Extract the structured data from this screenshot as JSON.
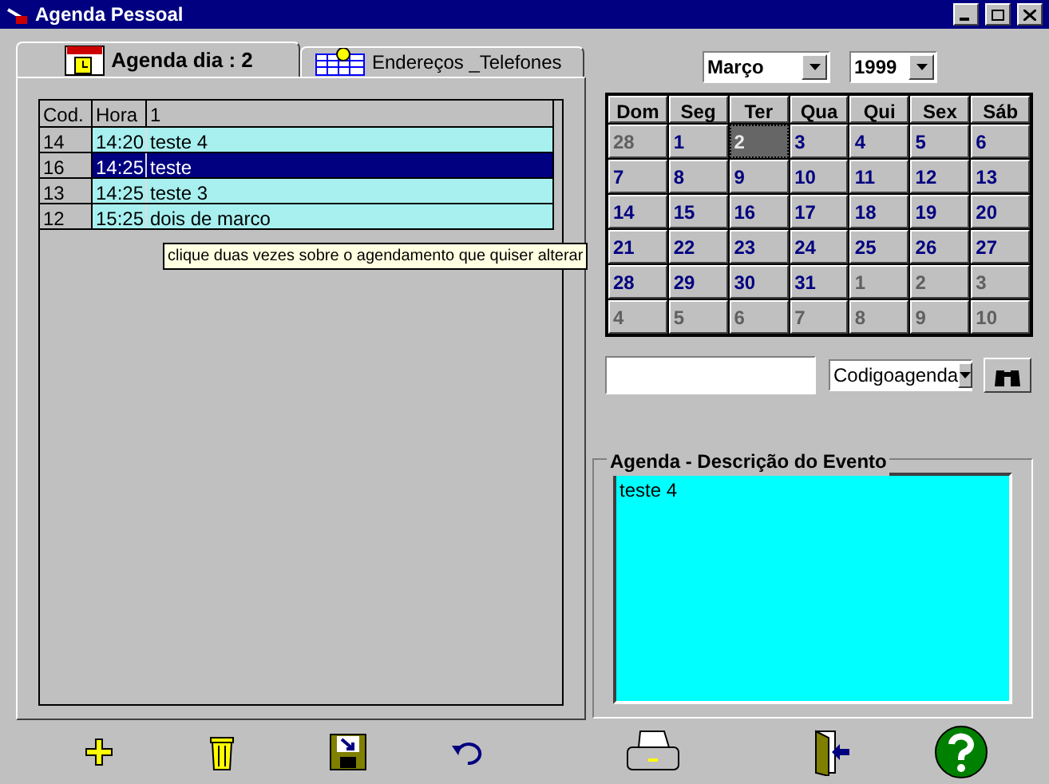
{
  "window": {
    "title": "Agenda Pessoal"
  },
  "tabs": [
    {
      "label": "Agenda dia : 2",
      "selected": true
    },
    {
      "label": "Endereços _Telefones",
      "selected": false
    }
  ],
  "table": {
    "columns": [
      "Cod.",
      "Hora",
      "1"
    ],
    "rows": [
      {
        "cells": [
          "14",
          "14:20",
          "teste 4"
        ],
        "selected": false
      },
      {
        "cells": [
          "16",
          "14:25",
          "teste"
        ],
        "selected": true
      },
      {
        "cells": [
          "13",
          "14:25",
          "teste 3"
        ],
        "selected": false
      },
      {
        "cells": [
          "12",
          "15:25",
          "dois de marco"
        ],
        "selected": false
      }
    ]
  },
  "tooltip": "clique duas vezes sobre o agendamento que quiser alterar",
  "month": "Março",
  "year": "1999",
  "calendar": {
    "weekdays": [
      "Dom",
      "Seg",
      "Ter",
      "Qua",
      "Qui",
      "Sex",
      "Sáb"
    ],
    "days": [
      {
        "day": "28",
        "in_month": false,
        "selected": false
      },
      {
        "day": "1",
        "in_month": true,
        "selected": false
      },
      {
        "day": "2",
        "in_month": true,
        "selected": true
      },
      {
        "day": "3",
        "in_month": true,
        "selected": false
      },
      {
        "day": "4",
        "in_month": true,
        "selected": false
      },
      {
        "day": "5",
        "in_month": true,
        "selected": false
      },
      {
        "day": "6",
        "in_month": true,
        "selected": false
      },
      {
        "day": "7",
        "in_month": true,
        "selected": false
      },
      {
        "day": "8",
        "in_month": true,
        "selected": false
      },
      {
        "day": "9",
        "in_month": true,
        "selected": false
      },
      {
        "day": "10",
        "in_month": true,
        "selected": false
      },
      {
        "day": "11",
        "in_month": true,
        "selected": false
      },
      {
        "day": "12",
        "in_month": true,
        "selected": false
      },
      {
        "day": "13",
        "in_month": true,
        "selected": false
      },
      {
        "day": "14",
        "in_month": true,
        "selected": false
      },
      {
        "day": "15",
        "in_month": true,
        "selected": false
      },
      {
        "day": "16",
        "in_month": true,
        "selected": false
      },
      {
        "day": "17",
        "in_month": true,
        "selected": false
      },
      {
        "day": "18",
        "in_month": true,
        "selected": false
      },
      {
        "day": "19",
        "in_month": true,
        "selected": false
      },
      {
        "day": "20",
        "in_month": true,
        "selected": false
      },
      {
        "day": "21",
        "in_month": true,
        "selected": false
      },
      {
        "day": "22",
        "in_month": true,
        "selected": false
      },
      {
        "day": "23",
        "in_month": true,
        "selected": false
      },
      {
        "day": "24",
        "in_month": true,
        "selected": false
      },
      {
        "day": "25",
        "in_month": true,
        "selected": false
      },
      {
        "day": "26",
        "in_month": true,
        "selected": false
      },
      {
        "day": "27",
        "in_month": true,
        "selected": false
      },
      {
        "day": "28",
        "in_month": true,
        "selected": false
      },
      {
        "day": "29",
        "in_month": true,
        "selected": false
      },
      {
        "day": "30",
        "in_month": true,
        "selected": false
      },
      {
        "day": "31",
        "in_month": true,
        "selected": false
      },
      {
        "day": "1",
        "in_month": false,
        "selected": false
      },
      {
        "day": "2",
        "in_month": false,
        "selected": false
      },
      {
        "day": "3",
        "in_month": false,
        "selected": false
      },
      {
        "day": "4",
        "in_month": false,
        "selected": false
      },
      {
        "day": "5",
        "in_month": false,
        "selected": false
      },
      {
        "day": "6",
        "in_month": false,
        "selected": false
      },
      {
        "day": "7",
        "in_month": false,
        "selected": false
      },
      {
        "day": "8",
        "in_month": false,
        "selected": false
      },
      {
        "day": "9",
        "in_month": false,
        "selected": false
      },
      {
        "day": "10",
        "in_month": false,
        "selected": false
      }
    ]
  },
  "search_field": "Codigoagenda",
  "description": {
    "title": "Agenda  -  Descrição do Evento",
    "text": "teste 4"
  }
}
